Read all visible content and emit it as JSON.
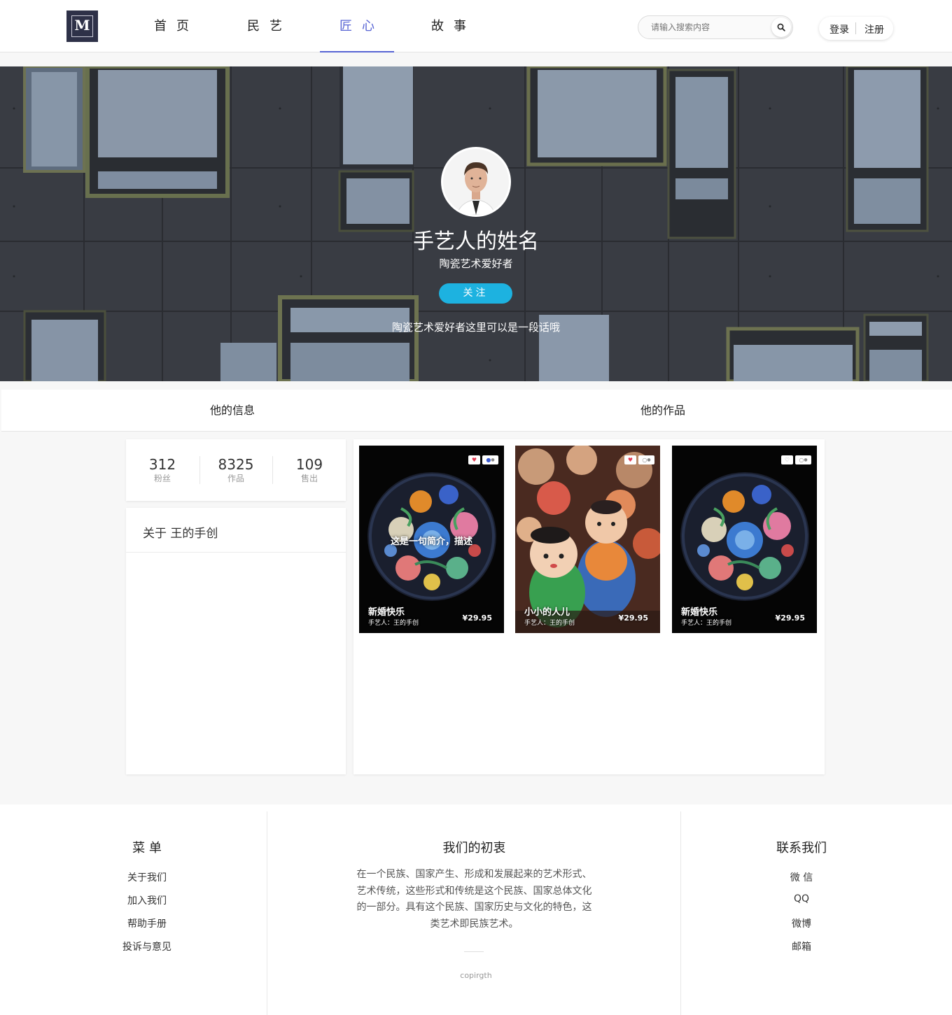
{
  "header": {
    "logo_letter": "M",
    "nav": [
      {
        "label": "首页",
        "active": false
      },
      {
        "label": "民艺",
        "active": false
      },
      {
        "label": "匠心",
        "active": true
      },
      {
        "label": "故事",
        "active": false
      }
    ],
    "search_placeholder": "请输入搜索内容",
    "login_label": "登录",
    "register_label": "注册",
    "active_color": "#5764d4"
  },
  "hero": {
    "name": "手艺人的姓名",
    "subtitle": "陶瓷艺术爱好者",
    "follow_label": "关注",
    "description": "陶瓷艺术爱好者这里可以是一段话哦",
    "follow_color": "#1db2e0"
  },
  "tabs": {
    "info_label": "他的信息",
    "works_label": "他的作品"
  },
  "stats": [
    {
      "value": "312",
      "label": "粉丝"
    },
    {
      "value": "8325",
      "label": "作品"
    },
    {
      "value": "109",
      "label": "售出"
    }
  ],
  "about": {
    "title": "关于 王的手创"
  },
  "works": [
    {
      "title": "新婚快乐",
      "maker": "手艺人：王的手创",
      "price": "¥29.95",
      "desc": "这是一句简介，描述",
      "image": "embroidery",
      "liked": true
    },
    {
      "title": "小小的人儿",
      "maker": "手艺人：王的手创",
      "price": "¥29.95",
      "desc": "",
      "image": "clay-dolls",
      "liked": true
    },
    {
      "title": "新婚快乐",
      "maker": "手艺人：王的手创",
      "price": "¥29.95",
      "desc": "",
      "image": "embroidery",
      "liked": false
    }
  ],
  "footer": {
    "menu_title": "菜 单",
    "menu_links": [
      "关于我们",
      "加入我们",
      "帮助手册",
      "投诉与意见"
    ],
    "mission_title": "我们的初衷",
    "mission_text": "在一个民族、国家产生、形成和发展起来的艺术形式、艺术传统，这些形式和传统是这个民族、国家总体文化的一部分。具有这个民族、国家历史与文化的特色，这类艺术即民族艺术。",
    "copyright": "copirgth",
    "contact_title": "联系我们",
    "contact_links": [
      "微 信",
      "QQ",
      "微博",
      "邮箱"
    ]
  }
}
